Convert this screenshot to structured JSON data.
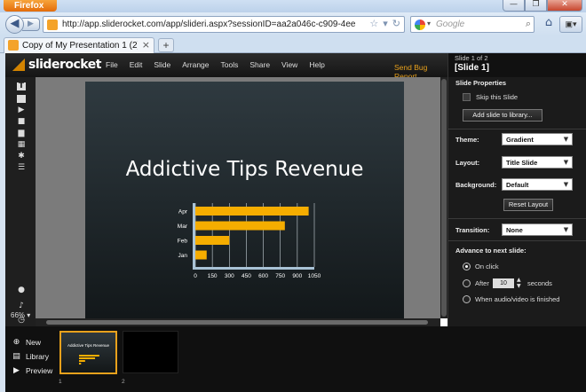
{
  "browser": {
    "app_button": "Firefox",
    "window_buttons": [
      "—",
      "❐",
      "✕"
    ],
    "url": "http://app.sliderocket.com/app/slideri.aspx?sessionID=aa2a046c-c909-4eea-84ed-9afdad36c",
    "search_placeholder": "Google",
    "tab_title": "Copy of My Presentation 1 (2) - SlideRo...",
    "newtab": "+"
  },
  "app": {
    "logo": "sliderocket",
    "menu": [
      "File",
      "Edit",
      "Slide",
      "Arrange",
      "Tools",
      "Share",
      "View",
      "Help"
    ],
    "bug_report": "Send Bug Report",
    "zoom": "66% ▾",
    "left_tools": [
      "text-tool-icon",
      "shape-tool-icon",
      "media-tool-icon",
      "clipart-tool-icon",
      "chart-tool-icon",
      "table-tool-icon",
      "plugin-tool-icon",
      "list-tool-icon",
      "comment-icon",
      "microphone-icon",
      "clock-icon"
    ]
  },
  "slide": {
    "title": "Addictive Tips Revenue"
  },
  "chart_data": {
    "type": "bar",
    "orientation": "horizontal",
    "categories": [
      "Apr",
      "Mar",
      "Feb",
      "Jan"
    ],
    "values": [
      1000,
      790,
      300,
      100
    ],
    "xticks": [
      0,
      150,
      300,
      450,
      600,
      750,
      900,
      1050
    ],
    "xlim": [
      0,
      1050
    ],
    "bar_color": "#f5ad00",
    "grid": true
  },
  "panel": {
    "slide_of": "Slide 1 of 2",
    "slide_name": "[Slide 1]",
    "properties_title": "Slide Properties",
    "skip_label": "Skip this Slide",
    "add_library_btn": "Add slide to library...",
    "theme_label": "Theme:",
    "theme_value": "Gradient",
    "layout_label": "Layout:",
    "layout_value": "Title Slide",
    "background_label": "Background:",
    "background_value": "Default",
    "reset_layout_btn": "Reset Layout",
    "transition_label": "Transition:",
    "transition_value": "None",
    "advance_title": "Advance to next slide:",
    "opt_on_click": "On click",
    "opt_after": "After",
    "after_value": "10",
    "seconds": "seconds",
    "opt_media": "When audio/video is finished"
  },
  "bottom": {
    "new": "New",
    "library": "Library",
    "preview": "Preview",
    "thumb1_title": "Addictive Tips Revenue",
    "thumb1_num": "1",
    "thumb2_num": "2"
  }
}
